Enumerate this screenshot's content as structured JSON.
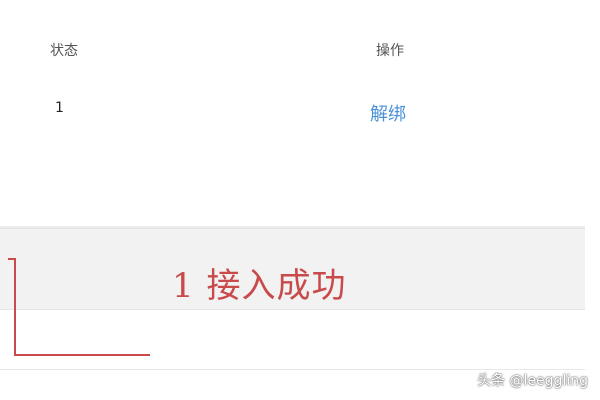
{
  "table": {
    "header": {
      "status_label": "状态",
      "action_label": "操作"
    },
    "rows": [
      {
        "status": "1",
        "action_link": "解绑"
      }
    ]
  },
  "annotation": {
    "text": "1 接入成功",
    "color": "#c94a4a"
  },
  "watermark": {
    "text": "头条 @leeggling"
  },
  "colors": {
    "header_background": "#f2f2f2",
    "link": "#4a90d9"
  }
}
